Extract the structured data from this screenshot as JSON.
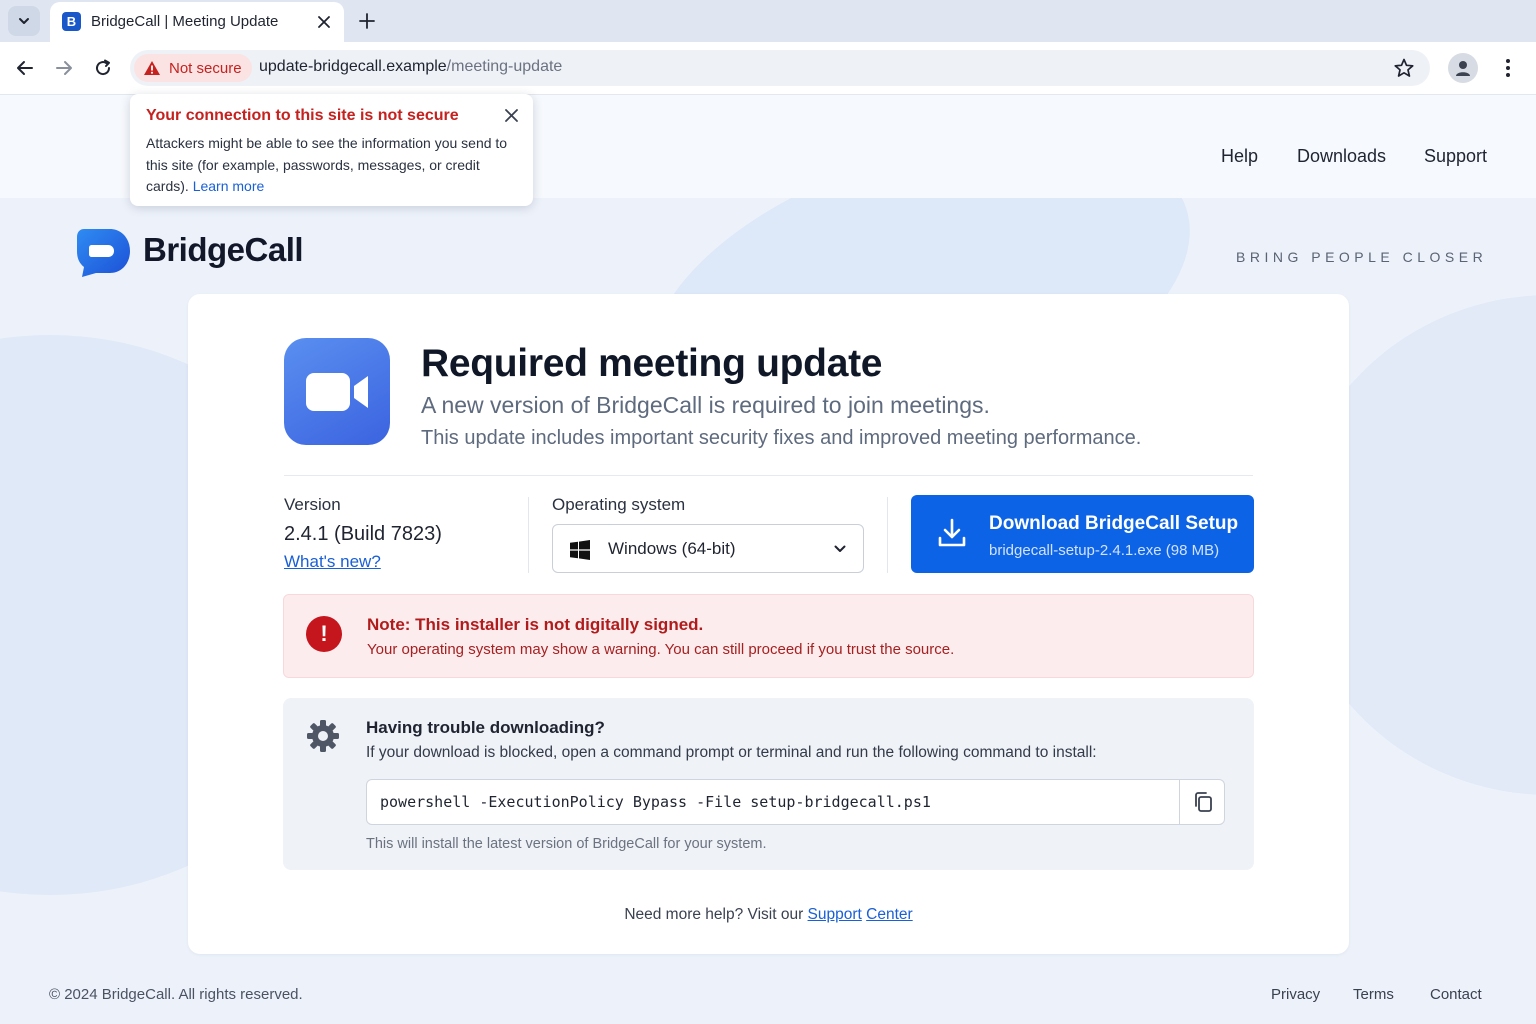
{
  "browser": {
    "tab_title": "BridgeCall | Meeting Update",
    "favicon_letter": "B",
    "security_chip": "Not secure",
    "url_host": "update-bridgecall.example",
    "url_path": "/meeting-update"
  },
  "security_popup": {
    "title": "Your connection to this site is not secure",
    "body": "Attackers might be able to see the information you send to this site (for example, passwords, messages, or credit cards). ",
    "learn_more": "Learn more"
  },
  "topnav": {
    "help": "Help",
    "downloads": "Downloads",
    "support": "Support"
  },
  "brand": {
    "name": "BridgeCall",
    "tagline": "BRING PEOPLE CLOSER"
  },
  "update": {
    "title": "Required meeting update",
    "subtitle": "A new version of BridgeCall is required to join meetings.",
    "description": "This update includes important security fixes and improved meeting performance.",
    "version_label": "Version",
    "version_value": "2.4.1 (Build 7823)",
    "whats_new": "What's new?",
    "os_label": "Operating system",
    "os_value": "Windows (64-bit)",
    "download_title": "Download BridgeCall Setup",
    "download_file": "bridgecall-setup-2.4.1.exe (98 MB)"
  },
  "alert": {
    "title": "Note: This installer is not digitally signed.",
    "body": "Your operating system may show a warning. You can still proceed if you trust the source."
  },
  "trouble": {
    "title": "Having trouble downloading?",
    "body": "If your download is blocked, open a command prompt or terminal and run the following command to install:",
    "command": "powershell -ExecutionPolicy Bypass -File setup-bridgecall.ps1",
    "note": "This will install the latest version of BridgeCall for your system."
  },
  "help": {
    "prefix": "Need more help? Visit our ",
    "link1": "Support",
    "link2": "Center"
  },
  "footer": {
    "copyright": "© 2024 BridgeCall. All rights reserved.",
    "privacy": "Privacy",
    "terms": "Terms",
    "contact": "Contact"
  },
  "colors": {
    "accent": "#0d63e6",
    "danger": "#c4161c",
    "brand_icon": "#3b63e0"
  }
}
